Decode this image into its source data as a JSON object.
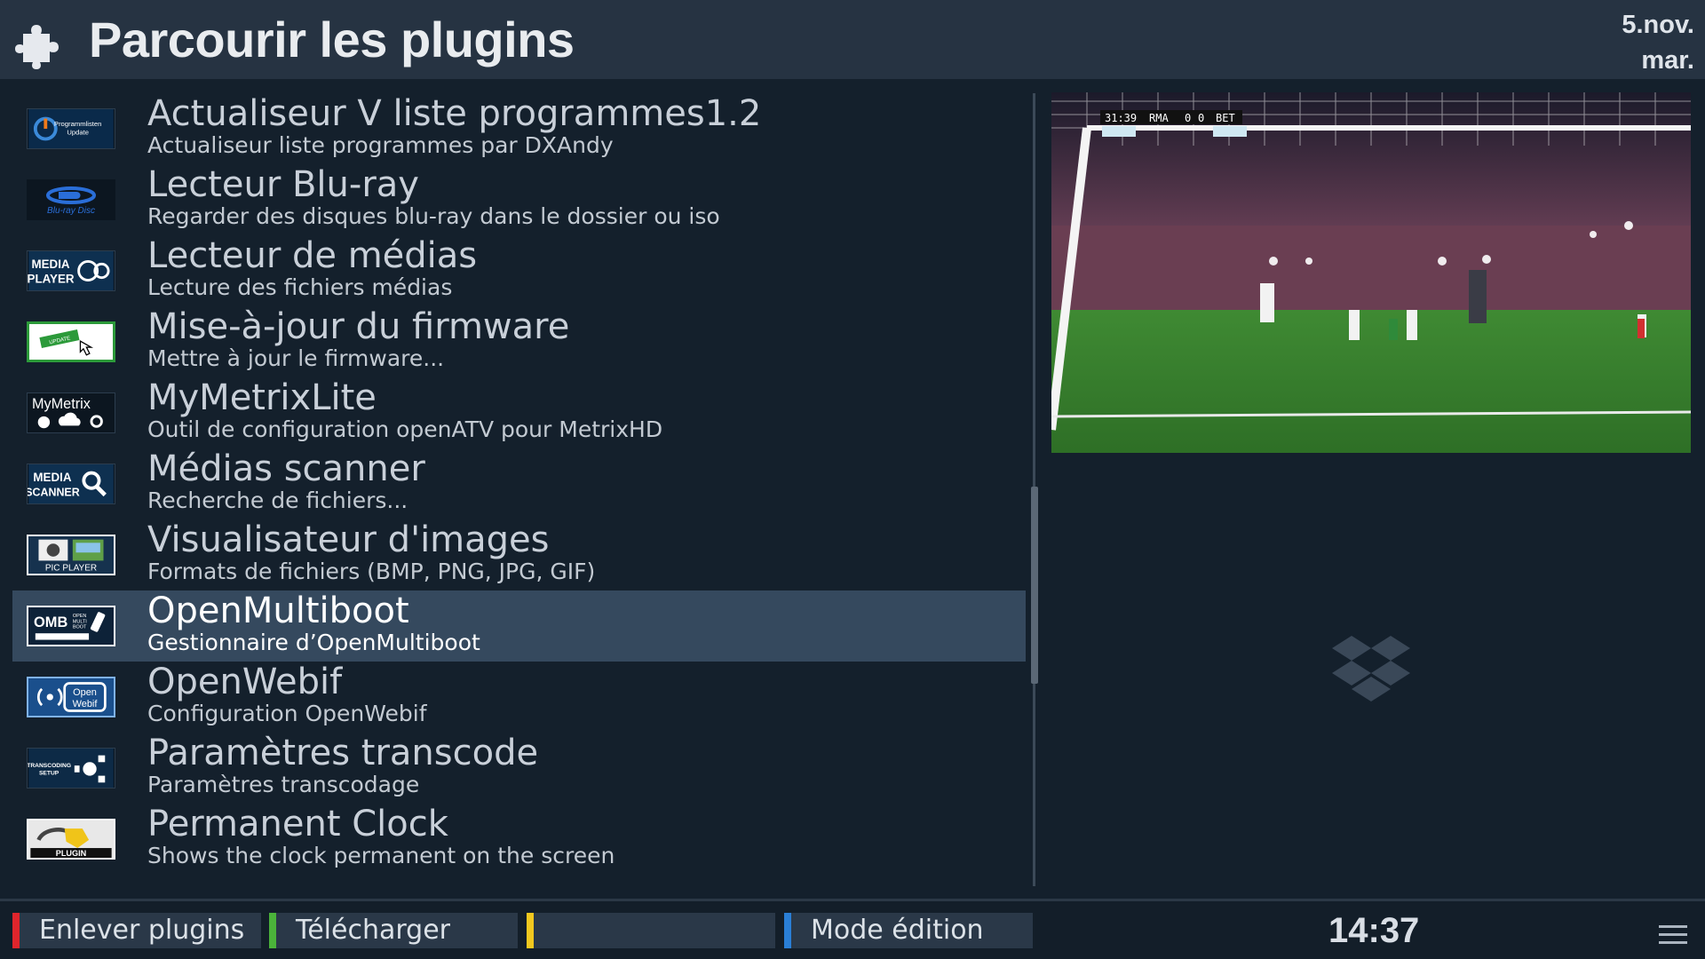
{
  "header": {
    "title": "Parcourir les plugins",
    "icon": "puzzle-icon",
    "date_line1": "5.nov.",
    "date_line2": "mar."
  },
  "plugins": [
    {
      "name": "Actualiseur V liste programmes1.2",
      "desc": "Actualiseur liste programmes par DXAndy",
      "icon": "programmlisten-update-icon",
      "icon_text": "Programmlisten Update"
    },
    {
      "name": "Lecteur Blu-ray",
      "desc": "Regarder des disques blu-ray dans le dossier ou iso",
      "icon": "bluray-disc-icon",
      "icon_text": "Blu-ray Disc"
    },
    {
      "name": "Lecteur de médias",
      "desc": "Lecture des fichiers médias",
      "icon": "media-player-icon",
      "icon_text": "MEDIA PLAYER"
    },
    {
      "name": "Mise-à-jour du firmware",
      "desc": "Mettre à jour le firmware...",
      "icon": "firmware-update-icon",
      "icon_text": "UPDATE"
    },
    {
      "name": "MyMetrixLite",
      "desc": "Outil de configuration openATV pour MetrixHD",
      "icon": "mymetrix-icon",
      "icon_text": "MyMetrix"
    },
    {
      "name": "Médias scanner",
      "desc": "Recherche de fichiers...",
      "icon": "media-scanner-icon",
      "icon_text": "MEDIA SCANNER"
    },
    {
      "name": "Visualisateur d'images",
      "desc": "Formats de fichiers (BMP, PNG, JPG, GIF)",
      "icon": "pic-player-icon",
      "icon_text": "PIC PLAYER"
    },
    {
      "name": "OpenMultiboot",
      "desc": "Gestionnaire d’OpenMultiboot",
      "icon": "openmultiboot-icon",
      "icon_text": "OMB",
      "selected": true
    },
    {
      "name": "OpenWebif",
      "desc": "Configuration OpenWebif",
      "icon": "openwebif-icon",
      "icon_text": "Open Webif"
    },
    {
      "name": "Paramètres transcode",
      "desc": "Paramètres transcodage",
      "icon": "transcoding-setup-icon",
      "icon_text": "TRANSCODING SETUP"
    },
    {
      "name": "Permanent Clock",
      "desc": "Shows the clock permanent on the screen",
      "icon": "plugin-icon",
      "icon_text": "PLUGIN"
    }
  ],
  "preview": {
    "scoreboard_time": "31:39",
    "team_home": "RMA",
    "score_home": "0",
    "score_away": "0",
    "team_away": "BET"
  },
  "footer": {
    "red_label": "Enlever plugins",
    "green_label": "Télécharger",
    "yellow_label": "",
    "blue_label": "Mode édition",
    "clock": "14:37",
    "colors": {
      "red": "#e0252c",
      "green": "#4bb33a",
      "yellow": "#f2c81f",
      "blue": "#2a7fd6"
    }
  }
}
